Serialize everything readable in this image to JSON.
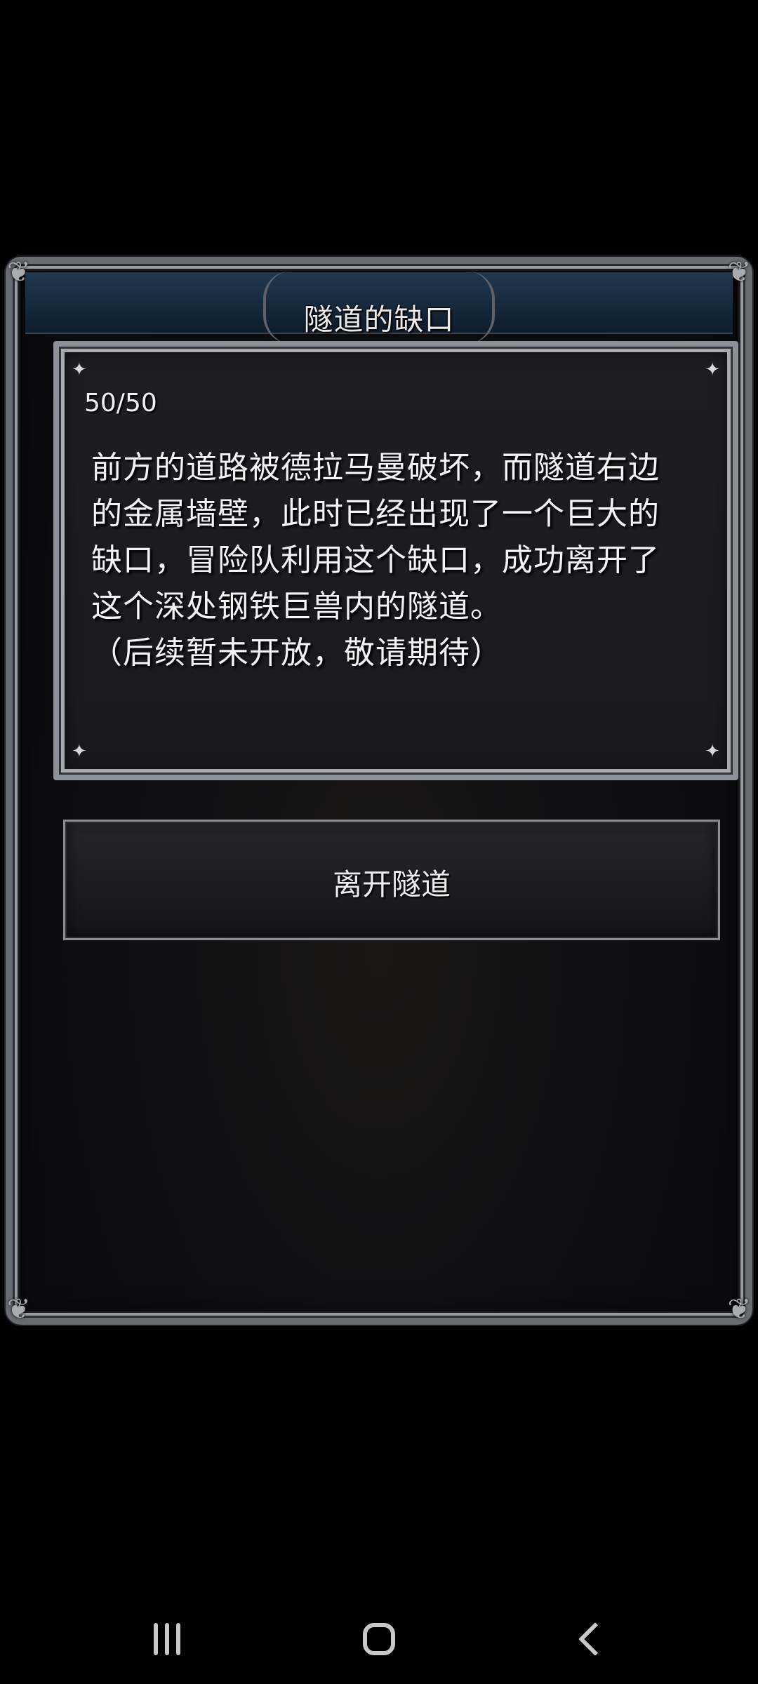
{
  "dialog": {
    "title": "隧道的缺口",
    "progress_counter": "50/50",
    "story_lines": [
      "前方的道路被德拉马曼破坏，而隧道右边",
      "的金属墙壁，此时已经出现了一个巨大的",
      "缺口，冒险队利用这个缺口，成功离开了",
      "这个深处钢铁巨兽内的隧道。",
      "（后续暂未开放，敬请期待）"
    ],
    "action_button_label": "离开隧道"
  },
  "nav_bar": {
    "recents_icon": "recents-icon",
    "home_icon": "home-icon",
    "back_icon": "back-icon"
  },
  "colors": {
    "title_band": "#1a2e42",
    "frame_silver": "#8e9097",
    "panel_bg": "#1c1c20",
    "text": "#f4f4f6"
  }
}
